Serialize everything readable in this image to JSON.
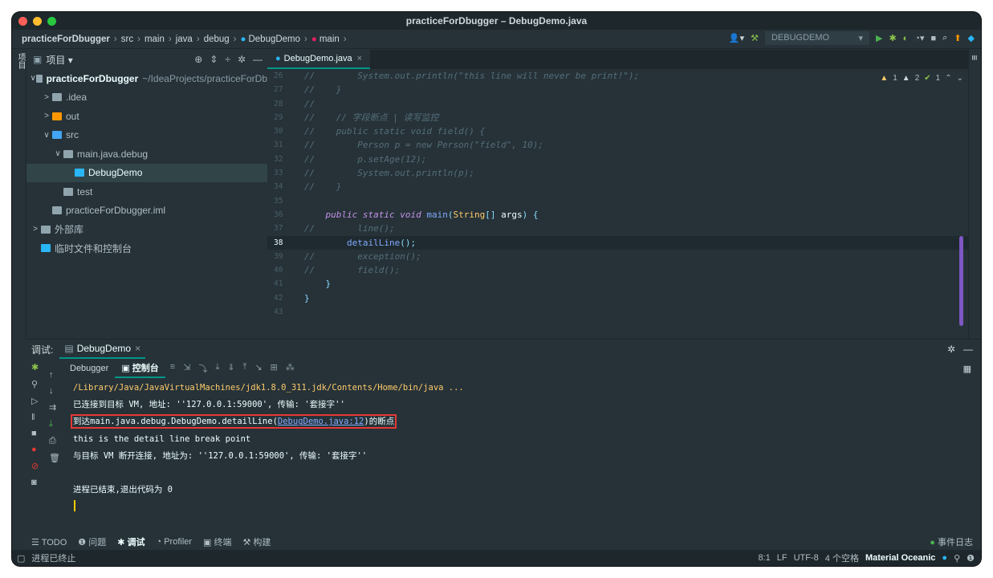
{
  "window": {
    "title": "practiceForDbugger – DebugDemo.java"
  },
  "breadcrumb": [
    "practiceForDbugger",
    "src",
    "main",
    "java",
    "debug",
    "DebugDemo",
    "main"
  ],
  "run_config": "DEBUGDEMO",
  "left_strip_label": "项目",
  "project": {
    "header": "项目",
    "items": [
      {
        "label": "practiceForDbugger",
        "suffix": "~/IdeaProjects/practiceForDb",
        "indent": 0,
        "arrow": "∨",
        "color": "#90a4ae"
      },
      {
        "label": ".idea",
        "indent": 1,
        "arrow": ">",
        "color": "#90a4ae"
      },
      {
        "label": "out",
        "indent": 1,
        "arrow": ">",
        "color": "#ff9800"
      },
      {
        "label": "src",
        "indent": 1,
        "arrow": "∨",
        "color": "#42a5f5"
      },
      {
        "label": "main.java.debug",
        "indent": 2,
        "arrow": "∨",
        "color": "#90a4ae"
      },
      {
        "label": "DebugDemo",
        "indent": 3,
        "arrow": "",
        "color": "#29b6f6",
        "selected": true
      },
      {
        "label": "test",
        "indent": 2,
        "arrow": "",
        "color": "#90a4ae"
      },
      {
        "label": "practiceForDbugger.iml",
        "indent": 1,
        "arrow": "",
        "color": "#90a4ae"
      },
      {
        "label": "外部库",
        "indent": 0,
        "arrow": ">",
        "color": "#90a4ae"
      },
      {
        "label": "临时文件和控制台",
        "indent": 0,
        "arrow": "",
        "color": "#29b6f6"
      }
    ]
  },
  "editor": {
    "tab": "DebugDemo.java",
    "inspections": {
      "warn1": "1",
      "warn2": "2",
      "ok": "1"
    },
    "lines": [
      {
        "n": "26",
        "segs": [
          [
            "cm",
            "//        System.out.println(\"this line will never be print!\");"
          ]
        ]
      },
      {
        "n": "27",
        "segs": [
          [
            "cm",
            "//    }"
          ]
        ]
      },
      {
        "n": "28",
        "segs": [
          [
            "cm",
            "//"
          ]
        ]
      },
      {
        "n": "29",
        "segs": [
          [
            "cm",
            "//    // 字段断点 | 读写监控"
          ]
        ]
      },
      {
        "n": "30",
        "segs": [
          [
            "cm",
            "//    public static void field() {"
          ]
        ]
      },
      {
        "n": "31",
        "segs": [
          [
            "cm",
            "//        Person p = new Person(\"field\", 10);"
          ]
        ]
      },
      {
        "n": "32",
        "segs": [
          [
            "cm",
            "//        p.setAge(12);"
          ]
        ]
      },
      {
        "n": "33",
        "segs": [
          [
            "cm",
            "//        System.out.println(p);"
          ]
        ]
      },
      {
        "n": "34",
        "segs": [
          [
            "cm",
            "//    }"
          ]
        ]
      },
      {
        "n": "35",
        "segs": []
      },
      {
        "n": "36",
        "segs": [
          [
            "tx",
            "    "
          ],
          [
            "kw",
            "public static void "
          ],
          [
            "fn",
            "main"
          ],
          [
            "pl",
            "("
          ],
          [
            "ty",
            "String"
          ],
          [
            "pl",
            "[] "
          ],
          [
            "tx",
            "args"
          ],
          [
            "pl",
            ") {"
          ]
        ]
      },
      {
        "n": "37",
        "segs": [
          [
            "cm",
            "//        line();"
          ]
        ]
      },
      {
        "n": "38",
        "segs": [
          [
            "tx",
            "        "
          ],
          [
            "fn",
            "detailLine"
          ],
          [
            "pl",
            "();"
          ]
        ],
        "current": true
      },
      {
        "n": "39",
        "segs": [
          [
            "cm",
            "//        exception();"
          ]
        ]
      },
      {
        "n": "40",
        "segs": [
          [
            "cm",
            "//        field();"
          ]
        ]
      },
      {
        "n": "41",
        "segs": [
          [
            "pl",
            "    }"
          ]
        ]
      },
      {
        "n": "42",
        "segs": [
          [
            "pl",
            "}"
          ]
        ]
      },
      {
        "n": "43",
        "segs": []
      }
    ]
  },
  "debug": {
    "label": "调试:",
    "tab": "DebugDemo",
    "toolbar": {
      "debugger": "Debugger",
      "console": "控制台"
    },
    "console_lines": [
      {
        "text": "/Library/Java/JavaVirtualMachines/jdk1.8.0_311.jdk/Contents/Home/bin/java ...",
        "color": "#ffcb6b"
      },
      {
        "text": "已连接到目标 VM, 地址: ''127.0.0.1:59000', 传输: '套接字''"
      },
      {
        "pre": "到达main.java.debug.DebugDemo.detailLine(",
        "link": "DebugDemo.java:12",
        "post": ")的断点",
        "highlight": true
      },
      {
        "text": "this is the detail line break point"
      },
      {
        "text": "与目标 VM 断开连接, 地址为: ''127.0.0.1:59000', 传输: '套接字''"
      },
      {
        "text": ""
      },
      {
        "text": "进程已结束,退出代码为 0"
      }
    ]
  },
  "bottom_tabs": [
    "TODO",
    "问题",
    "调试",
    "Profiler",
    "终端",
    "构建"
  ],
  "event_log": "事件日志",
  "status": {
    "left": "进程已终止",
    "position": "8:1",
    "line_sep": "LF",
    "encoding": "UTF-8",
    "indent": "4 个空格",
    "theme": "Material Oceanic"
  },
  "colors": {
    "accent": "#009688",
    "highlight_box": "#e53935",
    "bg": "#263238"
  }
}
